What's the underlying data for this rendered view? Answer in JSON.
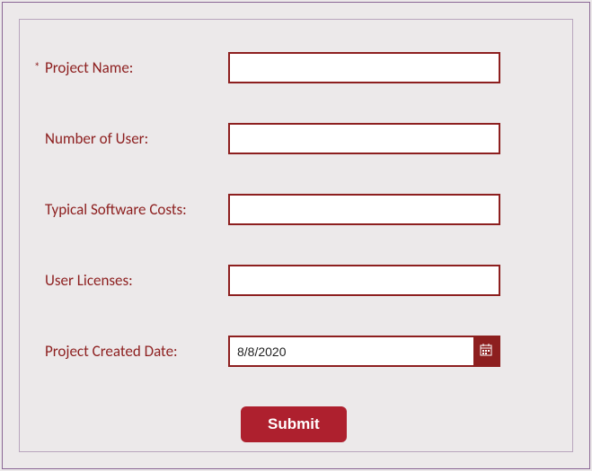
{
  "fields": {
    "project_name": {
      "label": "Project Name:",
      "value": "",
      "required": true
    },
    "number_of_user": {
      "label": "Number of User:",
      "value": ""
    },
    "typical_software_costs": {
      "label": "Typical Software Costs:",
      "value": ""
    },
    "user_licenses": {
      "label": "User Licenses:",
      "value": ""
    },
    "project_created_date": {
      "label": "Project Created Date:",
      "value": "8/8/2020"
    }
  },
  "actions": {
    "submit_label": "Submit"
  },
  "required_mark": "*"
}
